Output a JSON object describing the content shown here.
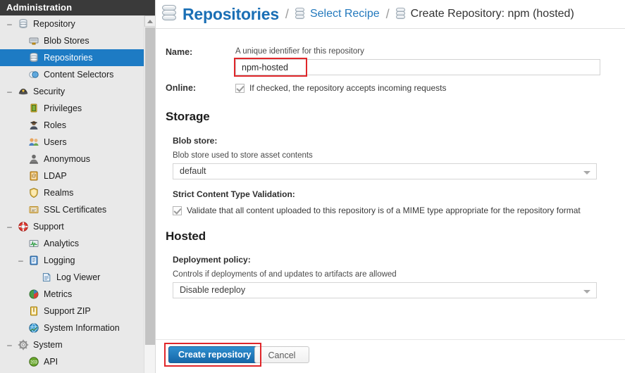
{
  "sidebar": {
    "header": "Administration",
    "items": [
      {
        "label": "Repository",
        "level": 0,
        "toggle": "–",
        "icon": "database-icon",
        "selected": false
      },
      {
        "label": "Blob Stores",
        "level": 1,
        "toggle": "",
        "icon": "blob-store-icon",
        "selected": false
      },
      {
        "label": "Repositories",
        "level": 1,
        "toggle": "",
        "icon": "database-icon",
        "selected": true
      },
      {
        "label": "Content Selectors",
        "level": 1,
        "toggle": "",
        "icon": "content-selector-icon",
        "selected": false
      },
      {
        "label": "Security",
        "level": 0,
        "toggle": "–",
        "icon": "security-hat-icon",
        "selected": false
      },
      {
        "label": "Privileges",
        "level": 1,
        "toggle": "",
        "icon": "privileges-icon",
        "selected": false
      },
      {
        "label": "Roles",
        "level": 1,
        "toggle": "",
        "icon": "roles-icon",
        "selected": false
      },
      {
        "label": "Users",
        "level": 1,
        "toggle": "",
        "icon": "users-icon",
        "selected": false
      },
      {
        "label": "Anonymous",
        "level": 1,
        "toggle": "",
        "icon": "anonymous-icon",
        "selected": false
      },
      {
        "label": "LDAP",
        "level": 1,
        "toggle": "",
        "icon": "ldap-icon",
        "selected": false
      },
      {
        "label": "Realms",
        "level": 1,
        "toggle": "",
        "icon": "realms-shield-icon",
        "selected": false
      },
      {
        "label": "SSL Certificates",
        "level": 1,
        "toggle": "",
        "icon": "ssl-certificate-icon",
        "selected": false
      },
      {
        "label": "Support",
        "level": 0,
        "toggle": "–",
        "icon": "lifebuoy-icon",
        "selected": false
      },
      {
        "label": "Analytics",
        "level": 1,
        "toggle": "",
        "icon": "analytics-icon",
        "selected": false
      },
      {
        "label": "Logging",
        "level": 1,
        "toggle": "–",
        "icon": "logging-book-icon",
        "selected": false
      },
      {
        "label": "Log Viewer",
        "level": 2,
        "toggle": "",
        "icon": "log-viewer-icon",
        "selected": false
      },
      {
        "label": "Metrics",
        "level": 1,
        "toggle": "",
        "icon": "metrics-pie-icon",
        "selected": false
      },
      {
        "label": "Support ZIP",
        "level": 1,
        "toggle": "",
        "icon": "support-zip-icon",
        "selected": false
      },
      {
        "label": "System Information",
        "level": 1,
        "toggle": "",
        "icon": "system-information-icon",
        "selected": false
      },
      {
        "label": "System",
        "level": 0,
        "toggle": "–",
        "icon": "gear-icon",
        "selected": false
      },
      {
        "label": "API",
        "level": 1,
        "toggle": "",
        "icon": "api-icon",
        "selected": false
      }
    ]
  },
  "breadcrumb": {
    "title": "Repositories",
    "separator": "/",
    "link": "Select Recipe",
    "current": "Create Repository: npm (hosted)"
  },
  "form": {
    "name": {
      "label": "Name:",
      "helper": "A unique identifier for this repository",
      "value": "npm-hosted",
      "placeholder": ""
    },
    "online": {
      "label": "Online:",
      "checkbox_label": "If checked, the repository accepts incoming requests",
      "checked": true
    },
    "storage": {
      "heading": "Storage",
      "blob_store": {
        "label": "Blob store:",
        "helper": "Blob store used to store asset contents",
        "value": "default"
      },
      "strict_validation": {
        "label": "Strict Content Type Validation:",
        "checkbox_label": "Validate that all content uploaded to this repository is of a MIME type appropriate for the repository format",
        "checked": true
      }
    },
    "hosted": {
      "heading": "Hosted",
      "deployment_policy": {
        "label": "Deployment policy:",
        "helper": "Controls if deployments of and updates to artifacts are allowed",
        "value": "Disable redeploy"
      }
    }
  },
  "footer": {
    "create_label": "Create repository",
    "cancel_label": "Cancel"
  },
  "colors": {
    "accent_blue": "#1d7bc4",
    "link_blue": "#2379bd",
    "title_blue": "#1a6fb5",
    "highlight_red": "#e0262a",
    "header_dark": "#3a3a3a"
  }
}
